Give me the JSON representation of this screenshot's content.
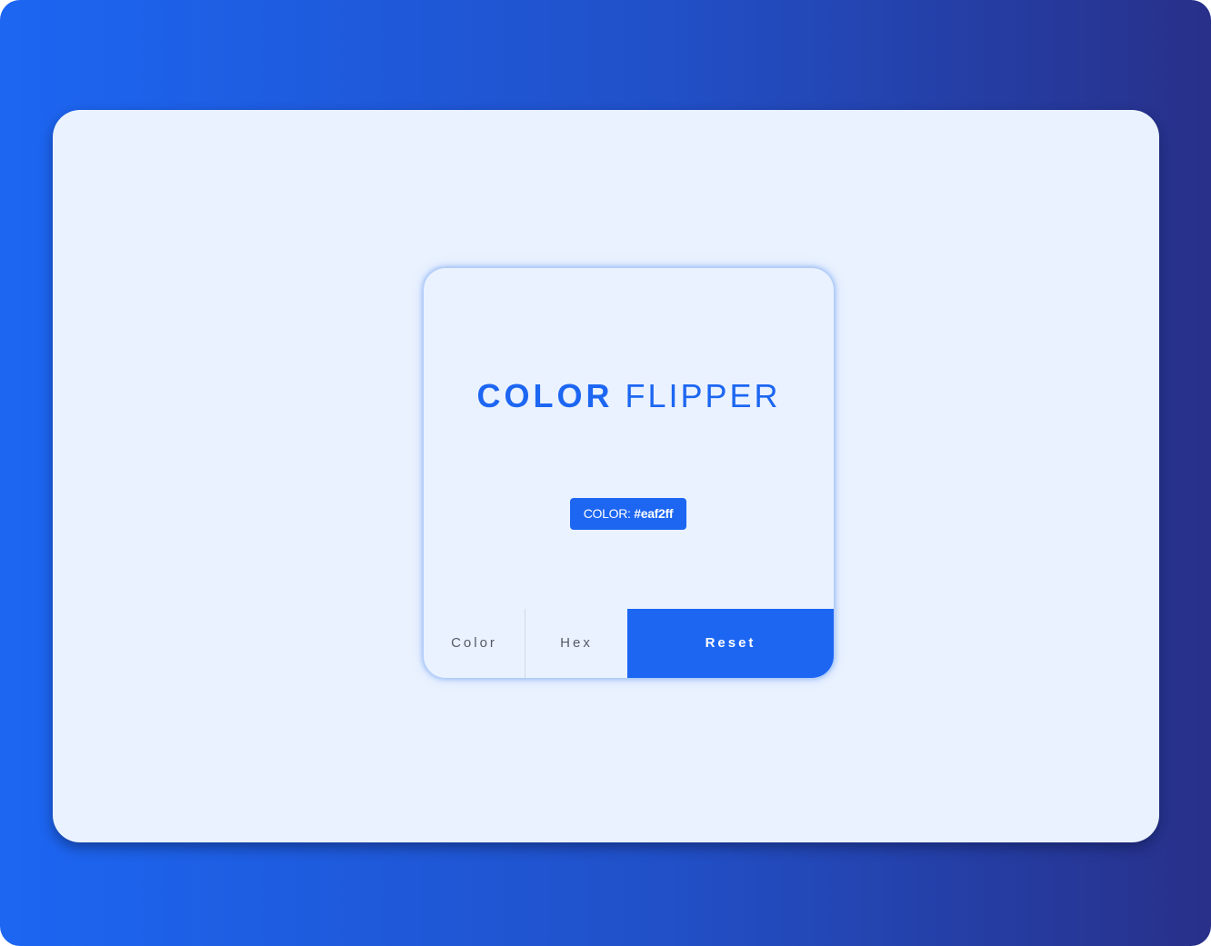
{
  "app": {
    "title_bold": "COLOR",
    "title_light": "FLIPPER"
  },
  "badge": {
    "label": "COLOR:",
    "value": "#eaf2ff"
  },
  "buttons": {
    "color_label": "Color",
    "hex_label": "Hex",
    "reset_label": "Reset"
  },
  "colors": {
    "accent": "#1c66f2",
    "background": "#eaf2ff",
    "gradient_start": "#1c66f2",
    "gradient_end": "#283089"
  }
}
